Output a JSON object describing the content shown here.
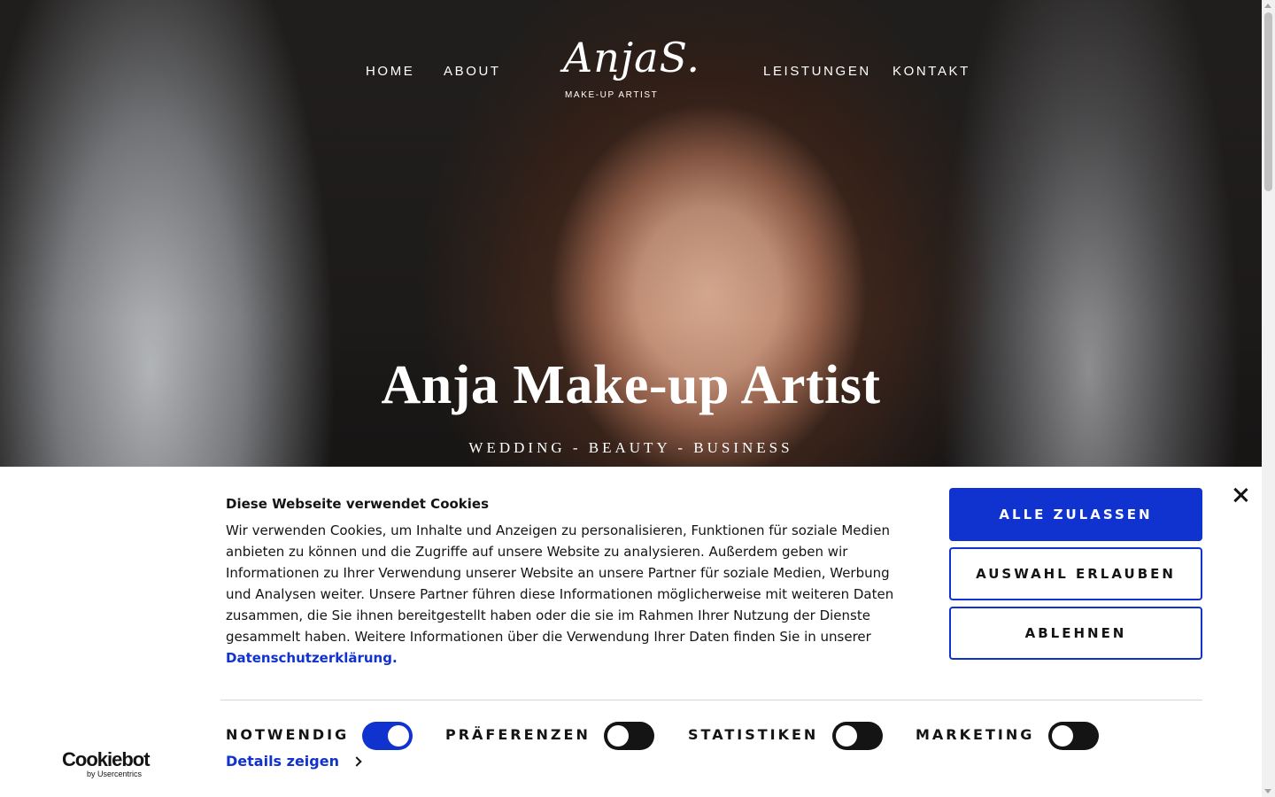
{
  "nav": {
    "home": "HOME",
    "about": "ABOUT",
    "leistungen": "LEISTUNGEN",
    "kontakt": "KONTAKT",
    "logo_script": "AnjaS.",
    "logo_sub": "MAKE-UP ARTIST"
  },
  "hero": {
    "title": "Anja Make-up Artist",
    "subtitle": "WEDDING - BEAUTY - BUSINESS"
  },
  "cookie": {
    "title": "Diese Webseite verwendet Cookies",
    "body": "Wir verwenden Cookies, um Inhalte und Anzeigen zu personalisieren, Funktionen für soziale Medien anbieten zu können und die Zugriffe auf unsere Website zu analysieren. Außerdem geben wir Informationen zu Ihrer Verwendung unserer Website an unsere Partner für soziale Medien, Werbung und Analysen weiter. Unsere Partner führen diese Informationen möglicherweise mit weiteren Daten zusammen, die Sie ihnen bereitgestellt haben oder die sie im Rahmen Ihrer Nutzung der Dienste gesammelt haben. Weitere Informationen über die Verwendung Ihrer Daten finden Sie in unserer",
    "privacy_link": "Datenschutzerklärung.",
    "buttons": {
      "allow_all": "ALLE ZULASSEN",
      "allow_selection": "AUSWAHL ERLAUBEN",
      "deny": "ABLEHNEN"
    },
    "toggles": [
      {
        "label": "NOTWENDIG",
        "on": true
      },
      {
        "label": "PRÄFERENZEN",
        "on": false
      },
      {
        "label": "STATISTIKEN",
        "on": false
      },
      {
        "label": "MARKETING",
        "on": false
      }
    ],
    "details_link": "Details zeigen",
    "brand": "Cookiebot",
    "brand_by": "by Usercentrics"
  },
  "colors": {
    "accent": "#1032cf",
    "toggle_off": "#141414",
    "text": "#141414"
  }
}
